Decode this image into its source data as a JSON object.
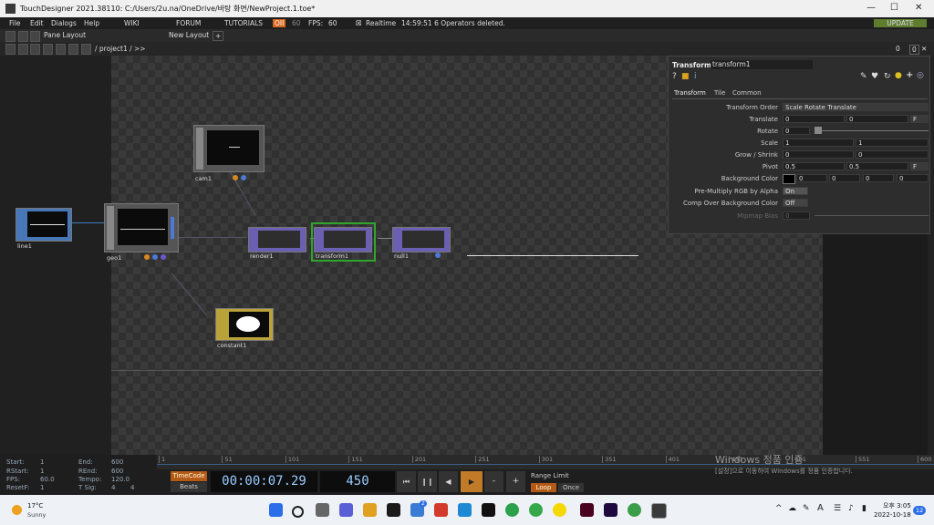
{
  "window": {
    "title": "TouchDesigner 2021.38110: C:/Users/2u.na/OneDrive/바탕 화면/NewProject.1.toe*"
  },
  "menu": {
    "items": [
      "File",
      "Edit",
      "Dialogs",
      "Help"
    ],
    "wiki": "WIKI",
    "forum": "FORUM",
    "tutorials": "TUTORIALS",
    "oli": "OII",
    "fps_target": "60",
    "fps_label": "FPS:",
    "fps_value": "60",
    "realtime": "Realtime",
    "status": "14:59:51 6 Operators deleted.",
    "update": "UPDATE"
  },
  "toolbar": {
    "pane_layout": "Pane Layout",
    "new_layout": "New Layout",
    "path": "/ project1 / >>",
    "pane_count_a": "0",
    "pane_count_b": "0"
  },
  "nodes": {
    "line": "line1",
    "geo": "geo1",
    "cam": "cam1",
    "render": "render1",
    "transform": "transform1",
    "null": "null1",
    "constant": "constant1"
  },
  "params": {
    "op_type": "Transform",
    "op_name": "transform1",
    "tabs": [
      "Transform",
      "Tile",
      "Common"
    ],
    "transform_order_label": "Transform Order",
    "transform_order_value": "Scale Rotate Translate",
    "translate_label": "Translate",
    "translate_x": "0",
    "translate_y": "0",
    "translate_unit": "F",
    "rotate_label": "Rotate",
    "rotate_value": "0",
    "scale_label": "Scale",
    "scale_x": "1",
    "scale_y": "1",
    "grow_label": "Grow / Shrink",
    "grow_x": "0",
    "grow_y": "0",
    "pivot_label": "Pivot",
    "pivot_x": "0.5",
    "pivot_y": "0.5",
    "pivot_unit": "F",
    "bgcolor_label": "Background Color",
    "bg_r": "0",
    "bg_g": "0",
    "bg_b": "0",
    "bg_a": "0",
    "premult_label": "Pre-Multiply RGB by Alpha",
    "premult_value": "On",
    "comp_label": "Comp Over Background Color",
    "comp_value": "Off",
    "mipmap_label": "Mipmap Bias",
    "mipmap_value": "0"
  },
  "timeline": {
    "start_label": "Start:",
    "start": "1",
    "end_label": "End:",
    "end": "600",
    "rstart_label": "RStart:",
    "rstart": "1",
    "rend_label": "REnd:",
    "rend": "600",
    "fps_label": "FPS:",
    "fps": "60.0",
    "tempo_label": "Tempo:",
    "tempo": "120.0",
    "resetf_label": "ResetF:",
    "resetf": "1",
    "tsig_label": "T Sig:",
    "tsig_a": "4",
    "tsig_b": "4",
    "ticks": [
      "1",
      "51",
      "101",
      "151",
      "201",
      "251",
      "301",
      "351",
      "401",
      "451",
      "501",
      "551",
      "600"
    ],
    "timecode_btn": "TimeCode",
    "beats_btn": "Beats",
    "timecode": "00:00:07.29",
    "frame": "450",
    "range_limit": "Range Limit",
    "loop": "Loop",
    "once": "Once"
  },
  "watermark": {
    "line1": "Windows 정품 인증",
    "line2": "[설정]으로 이동하여 Windows를 정품 인증합니다."
  },
  "taskbar": {
    "temp": "17°C",
    "weather": "Sunny",
    "ime": "A",
    "time": "오후 3:05",
    "date": "2022-10-18",
    "badge": "12",
    "badge_mail": "2"
  },
  "colors": {
    "accent_green": "#2fa52f",
    "op_purple": "#7b6bb8",
    "op_blue": "#3d7fc4",
    "op_yellow": "#b9a23a",
    "update": "#5f7d2e"
  }
}
